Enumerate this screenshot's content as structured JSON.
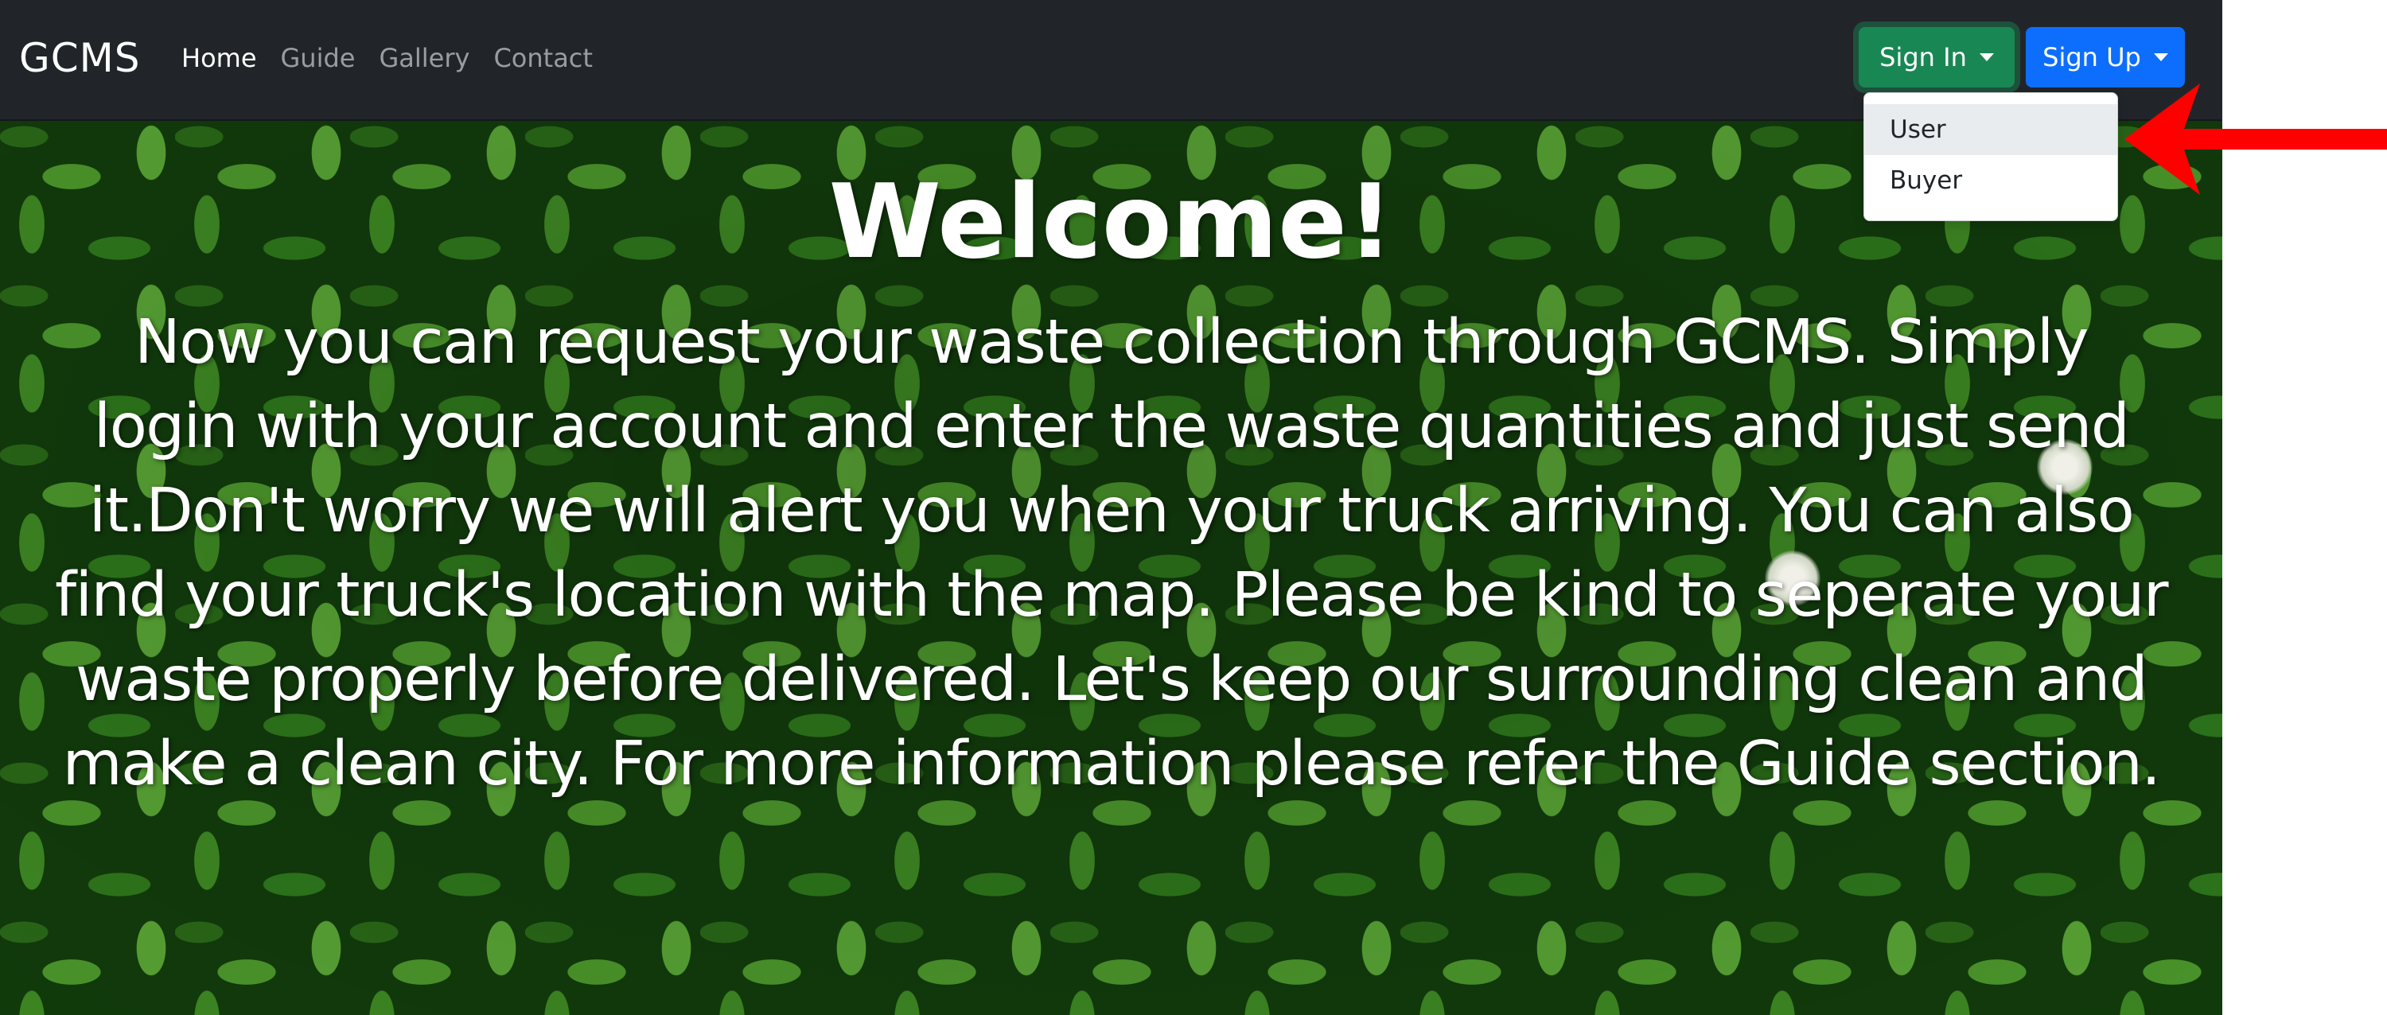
{
  "navbar": {
    "brand": "GCMS",
    "links": [
      {
        "label": "Home",
        "active": true
      },
      {
        "label": "Guide",
        "active": false
      },
      {
        "label": "Gallery",
        "active": false
      },
      {
        "label": "Contact",
        "active": false
      }
    ],
    "sign_in_label": "Sign In",
    "sign_up_label": "Sign Up"
  },
  "dropdown": {
    "items": [
      {
        "label": "User",
        "highlighted": true
      },
      {
        "label": "Buyer",
        "highlighted": false
      }
    ]
  },
  "hero": {
    "title": "Welcome!",
    "lines": [
      "Now you can request your waste collection through GCMS. Simply",
      "login with your account and enter the waste quantities and just send",
      "it.Don't worry we will alert you when your truck arriving. You can also",
      "find your truck's location with the map. Please be kind to seperate your",
      "waste properly before delivered. Let's keep our surrounding clean and",
      "make a clean city. For more information please refer the Guide section."
    ]
  },
  "icons": {
    "dropdown_caret": "caret-down-icon",
    "annotation": "red-arrow-icon"
  },
  "colors": {
    "navbar_bg": "#212529",
    "sign_in": "#198754",
    "sign_up": "#0d6efd",
    "arrow": "#ff0000"
  }
}
